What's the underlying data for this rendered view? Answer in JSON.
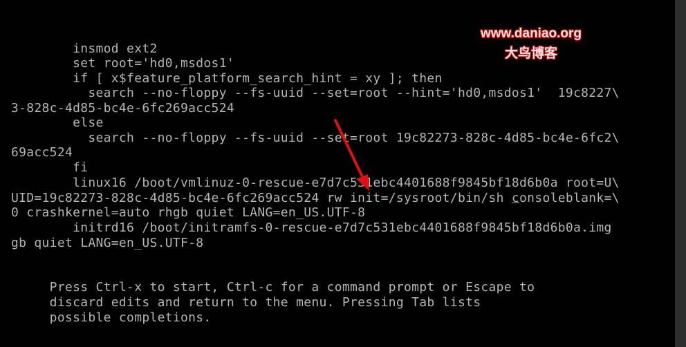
{
  "editor": {
    "lines": [
      "        insmod ext2",
      "        set root='hd0,msdos1'",
      "        if [ x$feature_platform_search_hint = xy ]; then",
      "          search --no-floppy --fs-uuid --set=root --hint='hd0,msdos1'  19c8227\\",
      "3-828c-4d85-bc4e-6fc269acc524",
      "        else",
      "          search --no-floppy --fs-uuid --set=root 19c82273-828c-4d85-bc4e-6fc2\\",
      "69acc524",
      "        fi",
      "        linux16 /boot/vmlinuz-0-rescue-e7d7c531ebc4401688f9845bf18d6b0a root=U\\",
      "UID=19c82273-828c-4d85-bc4e-6fc269acc524 rw init=/sysroot/bin/sh ",
      "0 crashkernel=auto rhgb quiet LANG=en_US.UTF-8",
      "        initrd16 /boot/initramfs-0-rescue-e7d7c531ebc4401688f9845bf18d6b0a.img",
      "gb quiet LANG=en_US.UTF-8"
    ],
    "cursor_word": "c",
    "line11_tail": "onsoleblank=\\"
  },
  "help": {
    "lines": [
      "     Press Ctrl-x to start, Ctrl-c for a command prompt or Escape to",
      "     discard edits and return to the menu. Pressing Tab lists",
      "     possible completions."
    ]
  },
  "watermark": {
    "url": "www.daniao.org",
    "name": "大鸟博客"
  },
  "scroll_indicator": "↑",
  "colors": {
    "text": "#b4b4b4",
    "background": "#000000",
    "arrow": "#e01010"
  }
}
